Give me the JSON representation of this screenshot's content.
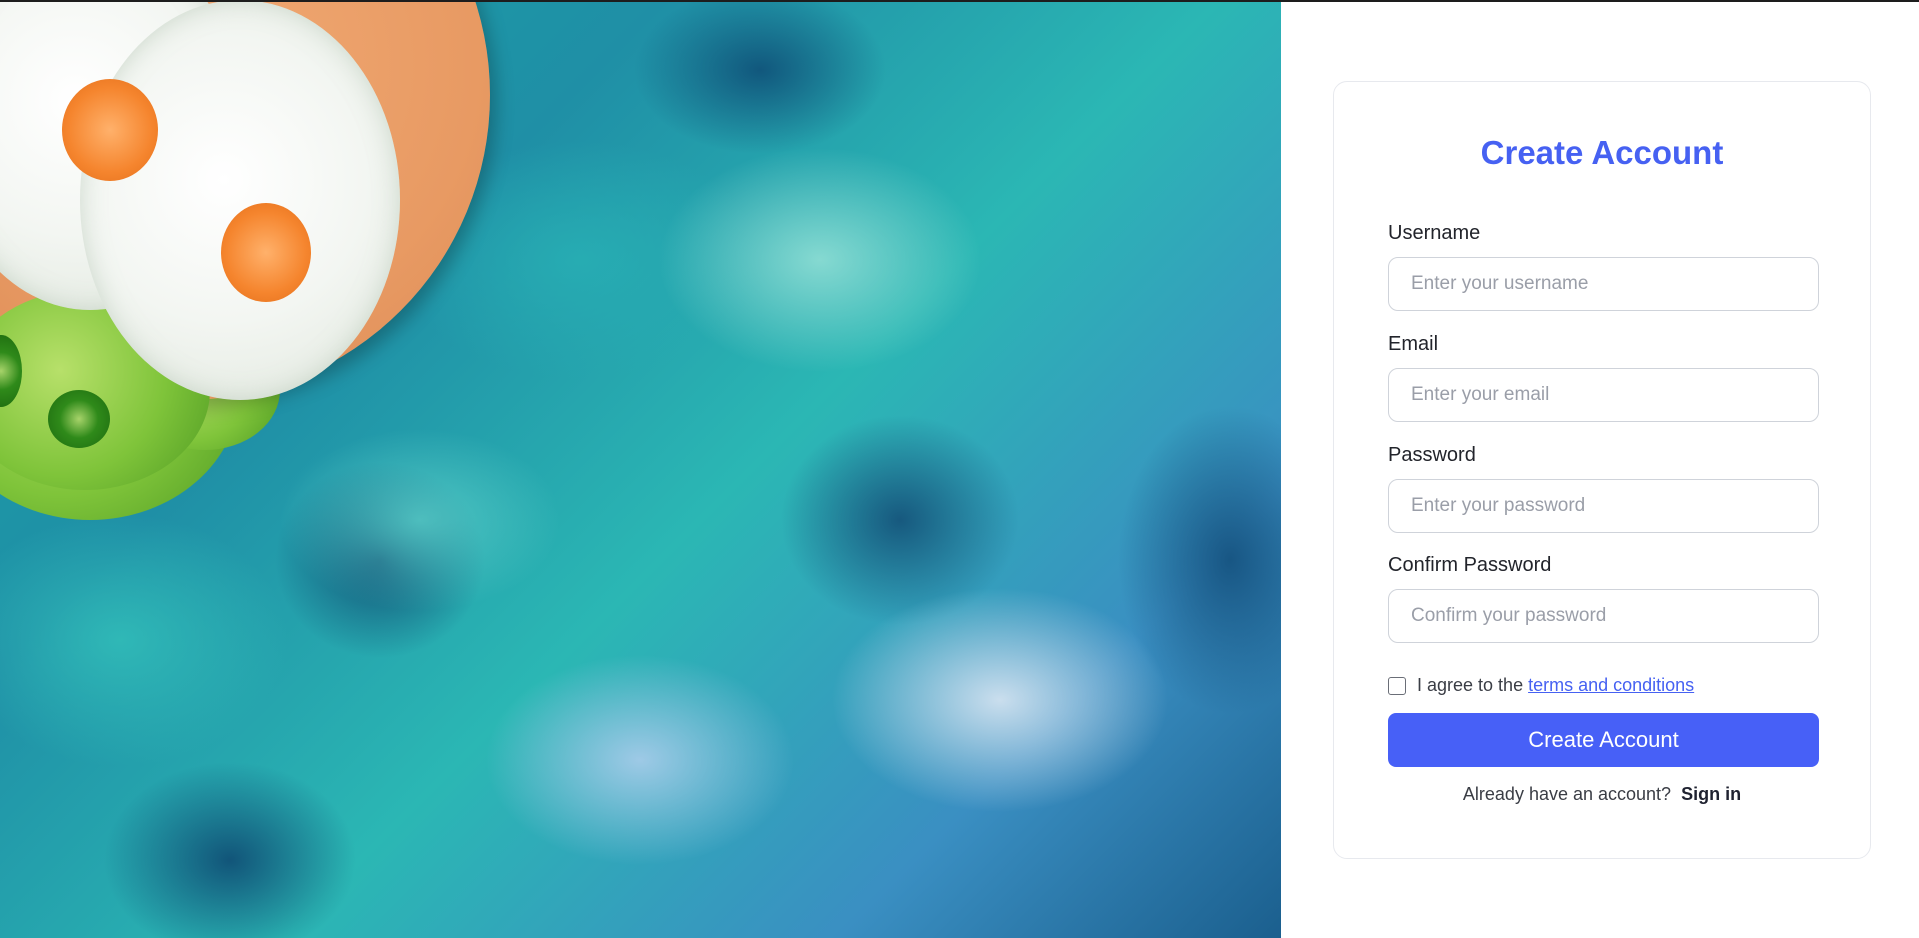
{
  "form": {
    "title": "Create Account",
    "fields": [
      {
        "label": "Username",
        "placeholder": "Enter your username",
        "value": ""
      },
      {
        "label": "Email",
        "placeholder": "Enter your email",
        "value": ""
      },
      {
        "label": "Password",
        "placeholder": "Enter your password",
        "value": ""
      },
      {
        "label": "Confirm Password",
        "placeholder": "Confirm your password",
        "value": ""
      }
    ],
    "terms": {
      "checked": false,
      "text": "I agree to the",
      "link_label": "terms and conditions"
    },
    "submit_label": "Create Account",
    "signin": {
      "prompt": "Already have an account?",
      "link_label": "Sign in"
    }
  },
  "colors": {
    "accent": "#4661f2",
    "button": "#4760f7",
    "border": "#cfd3da",
    "placeholder": "#9a9ea8"
  },
  "icons": {
    "checkbox": "checkbox-unchecked-icon"
  }
}
